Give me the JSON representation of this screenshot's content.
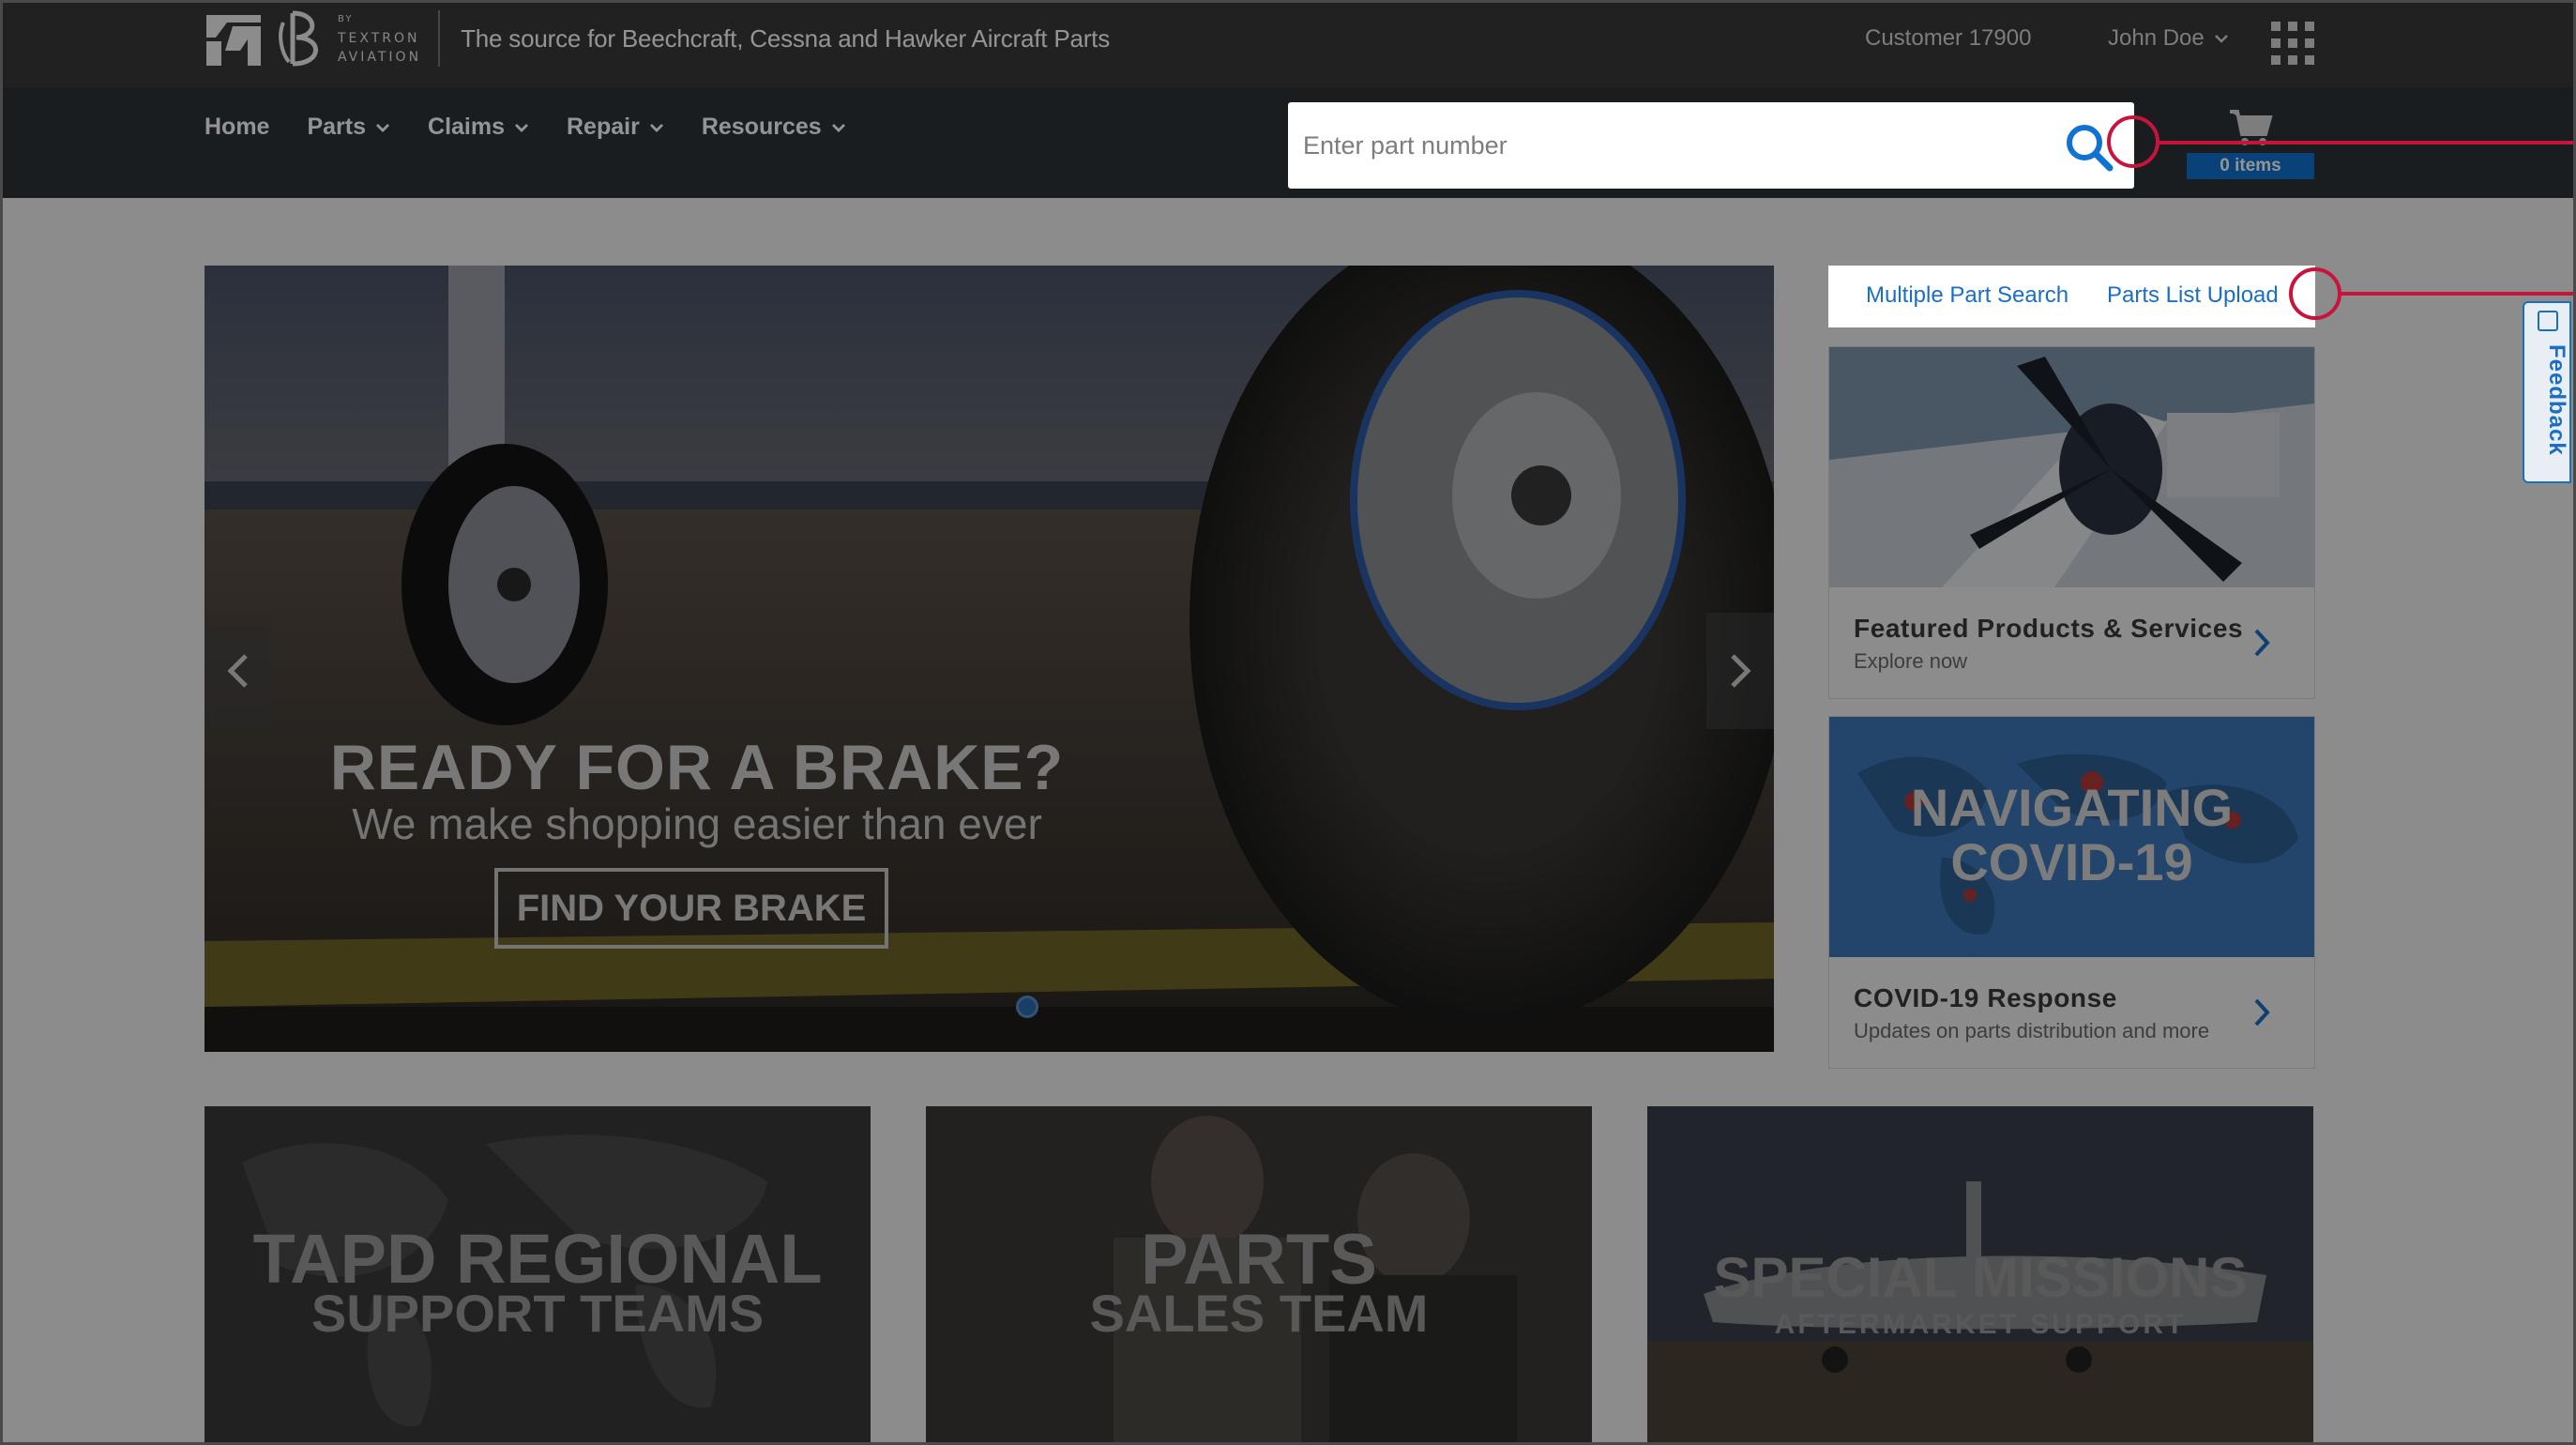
{
  "header": {
    "brand_by": "BY",
    "brand_textron": "TEXTRON",
    "brand_aviation": "AVIATION",
    "tagline": "The source for Beechcraft, Cessna and Hawker Aircraft Parts",
    "customer": "Customer 17900",
    "user_name": "John Doe"
  },
  "nav": {
    "items": [
      {
        "label": "Home",
        "has_menu": false
      },
      {
        "label": "Parts",
        "has_menu": true
      },
      {
        "label": "Claims",
        "has_menu": true
      },
      {
        "label": "Repair",
        "has_menu": true
      },
      {
        "label": "Resources",
        "has_menu": true
      }
    ]
  },
  "search": {
    "placeholder": "Enter part number",
    "value": ""
  },
  "cart": {
    "items_label": "0 items"
  },
  "hero": {
    "title": "READY FOR A BRAKE?",
    "subtitle": "We make shopping easier than ever",
    "cta": "FIND YOUR BRAKE"
  },
  "quick_links": {
    "multiple_part_search": "Multiple Part Search",
    "parts_list_upload": "Parts List Upload"
  },
  "cards": [
    {
      "title": "Featured Products & Services",
      "subtitle": "Explore now"
    },
    {
      "title": "COVID-19 Response",
      "subtitle": "Updates on parts distribution and more",
      "image_line1": "NAVIGATING",
      "image_line2": "COVID-19"
    }
  ],
  "tiles": [
    {
      "line1": "TAPD REGIONAL",
      "line2": "SUPPORT TEAMS"
    },
    {
      "line1": "PARTS",
      "line2": "SALES TEAM"
    },
    {
      "line1": "SPECIAL MISSIONS",
      "line2": "AFTERMARKET SUPPORT"
    }
  ],
  "feedback": {
    "label": "Feedback"
  },
  "colors": {
    "accent_blue": "#1173d1",
    "link_blue": "#1a6fc3",
    "callout_red": "#c8143c",
    "topbar": "#3a3a3a",
    "navbar": "#2c3238"
  },
  "icons": [
    "textron-logo-icon",
    "beechcraft-b-icon",
    "chevron-down-icon",
    "app-grid-icon",
    "search-icon",
    "cart-icon",
    "chevron-left-icon",
    "chevron-right-icon",
    "plus-square-icon"
  ]
}
